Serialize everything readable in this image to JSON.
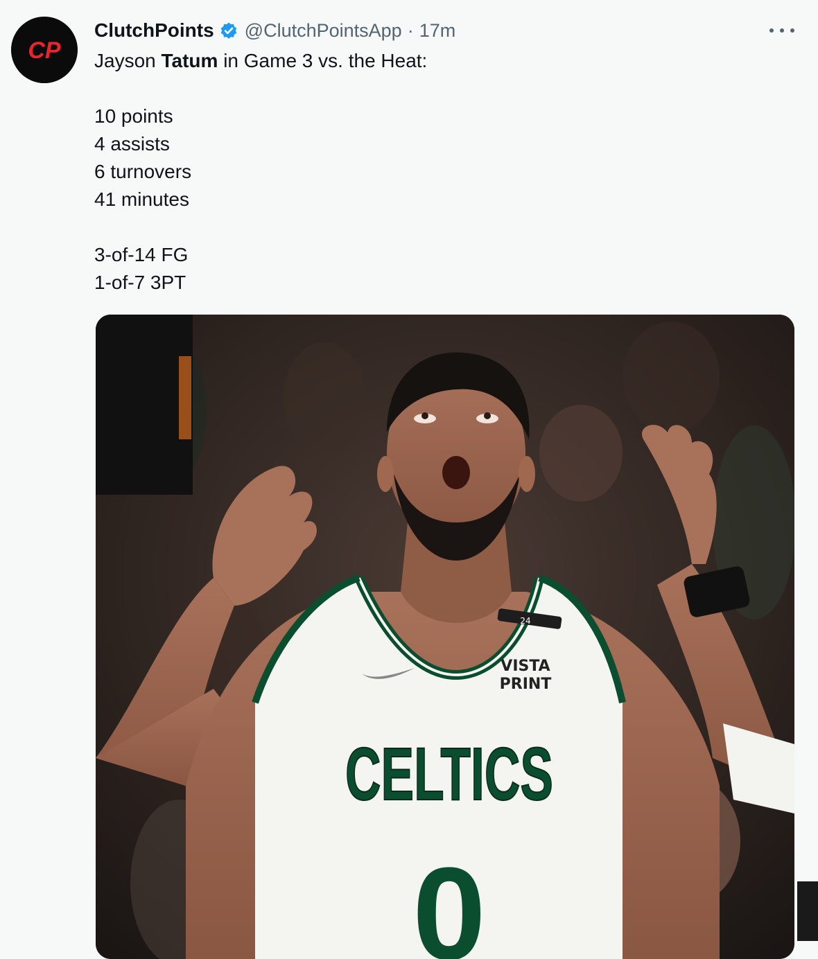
{
  "tweet": {
    "author": {
      "display_name": "ClutchPoints",
      "handle": "@ClutchPointsApp",
      "verified": true,
      "avatar_text": "CP",
      "avatar_icon": "clutchpoints-logo"
    },
    "separator": "·",
    "timestamp": "17m",
    "more_icon": "more-horizontal-icon",
    "text": {
      "intro_before": "Jayson ",
      "intro_bold": "Tatum",
      "intro_after": " in Game 3 vs. the Heat:",
      "stats": [
        "10 points",
        "4 assists",
        "6 turnovers",
        "41 minutes"
      ],
      "shooting": [
        "3-of-14 FG",
        "1-of-7 3PT"
      ]
    },
    "media": {
      "jersey_wordmark": "CELTICS",
      "jersey_number": "0",
      "jersey_patch": "24",
      "sponsor_line1": "VISTA",
      "sponsor_line2": "PRINT"
    }
  },
  "colors": {
    "background": "#f7f9f9",
    "text": "#0f1419",
    "secondary_text": "#536471",
    "verified_badge": "#1d9bf0",
    "avatar_accent": "#e8252c",
    "celtics_green": "#0b4d2f"
  }
}
